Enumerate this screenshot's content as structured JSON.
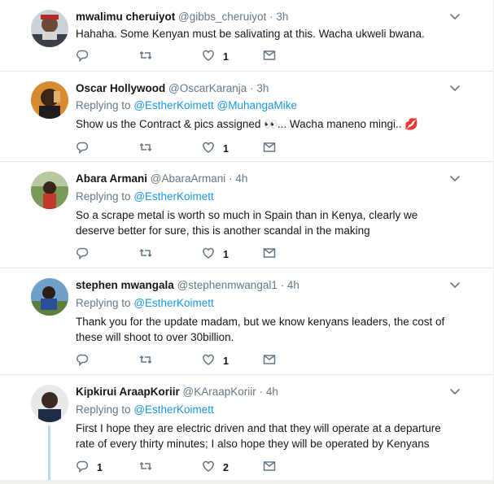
{
  "tweets": [
    {
      "name": "mwalimu cheruiyot",
      "handle": "@gibbs_cheruiyot",
      "time": "3h",
      "reply_label": "",
      "reply_targets": "",
      "text": "Hahaha. Some Kenyan must be salivating at this. Wacha ukweli bwana.",
      "reply_count": "",
      "retweet_count": "",
      "like_count": "1"
    },
    {
      "name": "Oscar Hollywood",
      "handle": "@OscarKaranja",
      "time": "3h",
      "reply_label": "Replying to",
      "reply_targets": "@EstherKoimett @MuhangaMike",
      "text": "Show us the Contract & pics assigned 👀... Wacha maneno mingi.. 💋",
      "reply_count": "",
      "retweet_count": "",
      "like_count": "1"
    },
    {
      "name": "Abara Armani",
      "handle": "@AbaraArmani",
      "time": "4h",
      "reply_label": "Replying to",
      "reply_targets": "@EstherKoimett",
      "text": "So a scrape metal is worth so much in Spain than in Kenya,  clearly we deserve better for sure,  this is another scandal in the making",
      "reply_count": "",
      "retweet_count": "",
      "like_count": "1"
    },
    {
      "name": "stephen mwangala",
      "handle": "@stephenmwangal1",
      "time": "4h",
      "reply_label": "Replying to",
      "reply_targets": "@EstherKoimett",
      "text": "Thank you for the update madam, but we know kenyans leaders, the cost of these will shoot to over 30billion.",
      "reply_count": "",
      "retweet_count": "",
      "like_count": "1"
    },
    {
      "name": "Kipkirui AraapKoriir",
      "handle": "@KAraapKoriir",
      "time": "4h",
      "reply_label": "Replying to",
      "reply_targets": "@EstherKoimett",
      "text": "First I hope they are electric driven and that they will operate at a departure rate of every thirty minutes; I also hope they will be operated by Kenyans",
      "reply_count": "1",
      "retweet_count": "",
      "like_count": "2"
    }
  ],
  "separator": "·",
  "colors": {
    "link": "#1b95e0",
    "secondary_text": "#657786",
    "border": "#e1e8ed",
    "thread_line": "#b9dcf5"
  },
  "icons": [
    "reply-icon",
    "retweet-icon",
    "like-icon",
    "direct-message-icon",
    "chevron-down-icon"
  ]
}
